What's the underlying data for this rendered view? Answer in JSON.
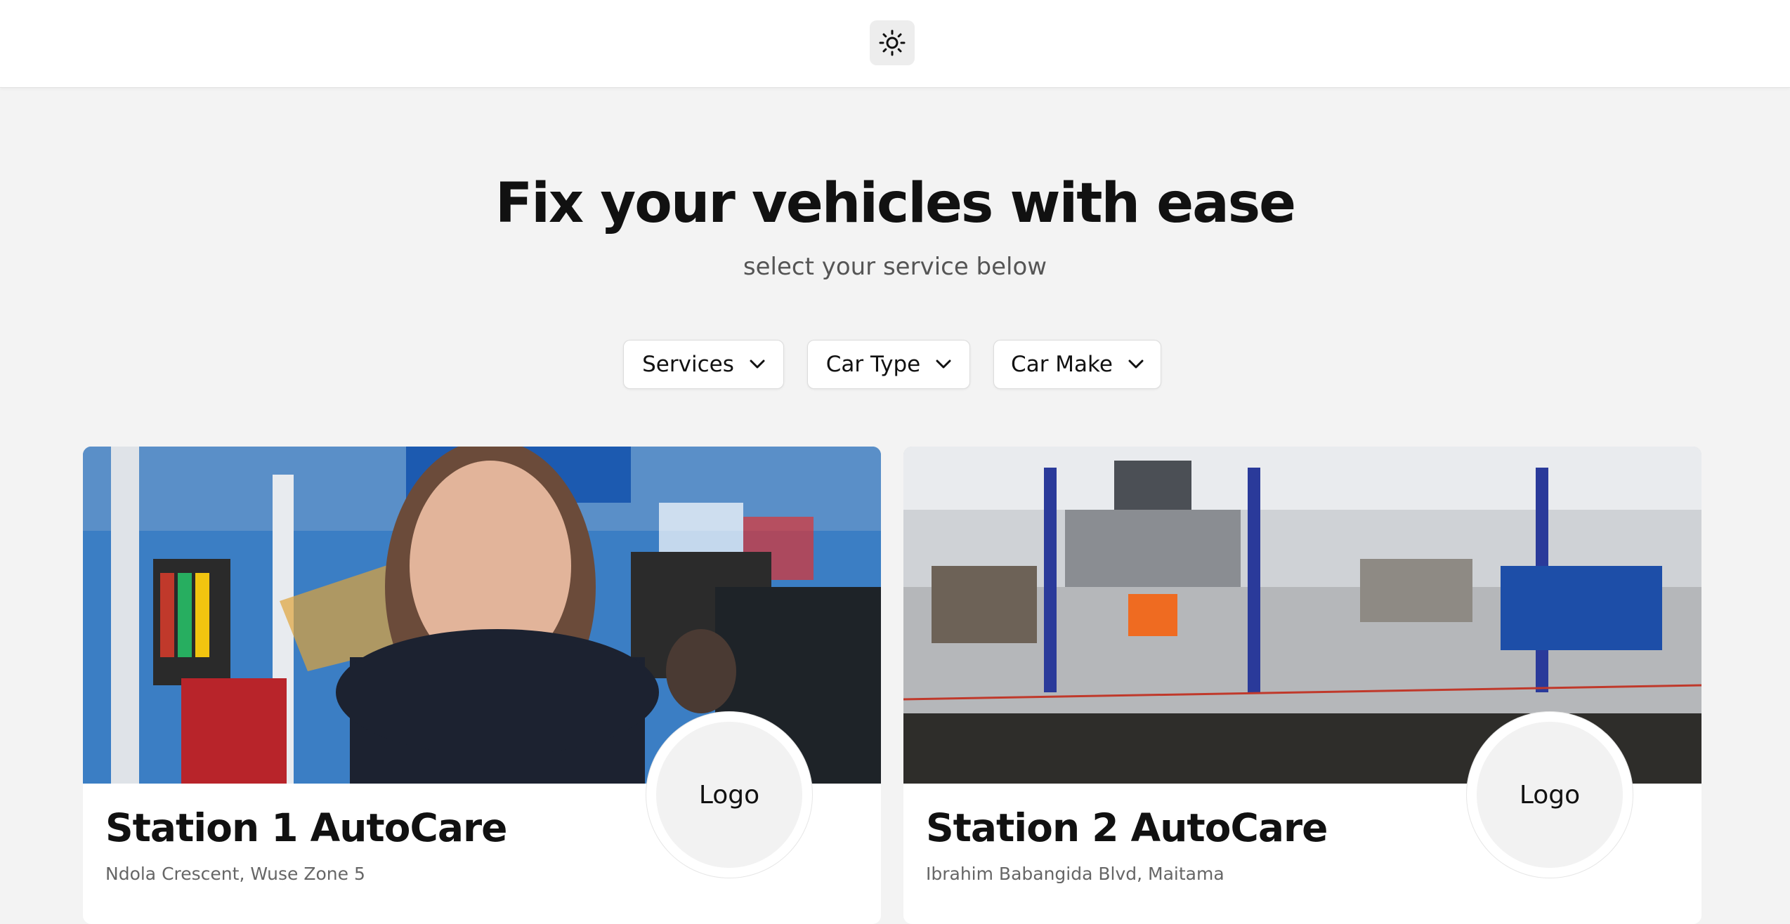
{
  "header": {
    "theme_toggle_icon": "sun-icon"
  },
  "hero": {
    "title": "Fix your vehicles with ease",
    "subtitle": "select your service below"
  },
  "filters": [
    {
      "label": "Services",
      "icon": "chevron-down-icon"
    },
    {
      "label": "Car Type",
      "icon": "chevron-down-icon"
    },
    {
      "label": "Car Make",
      "icon": "chevron-down-icon"
    }
  ],
  "stations": [
    {
      "name": "Station 1 AutoCare",
      "address": "Ndola Crescent, Wuse Zone 5",
      "logo_text": "Logo",
      "image": "mechanic-portrait-photo"
    },
    {
      "name": "Station 2 AutoCare",
      "address": "Ibrahim Babangida Blvd, Maitama",
      "logo_text": "Logo",
      "image": "garage-workshop-photo"
    }
  ],
  "colors": {
    "page_bg": "#f3f3f3",
    "card_bg": "#ffffff",
    "text": "#111111",
    "muted": "#666666"
  }
}
